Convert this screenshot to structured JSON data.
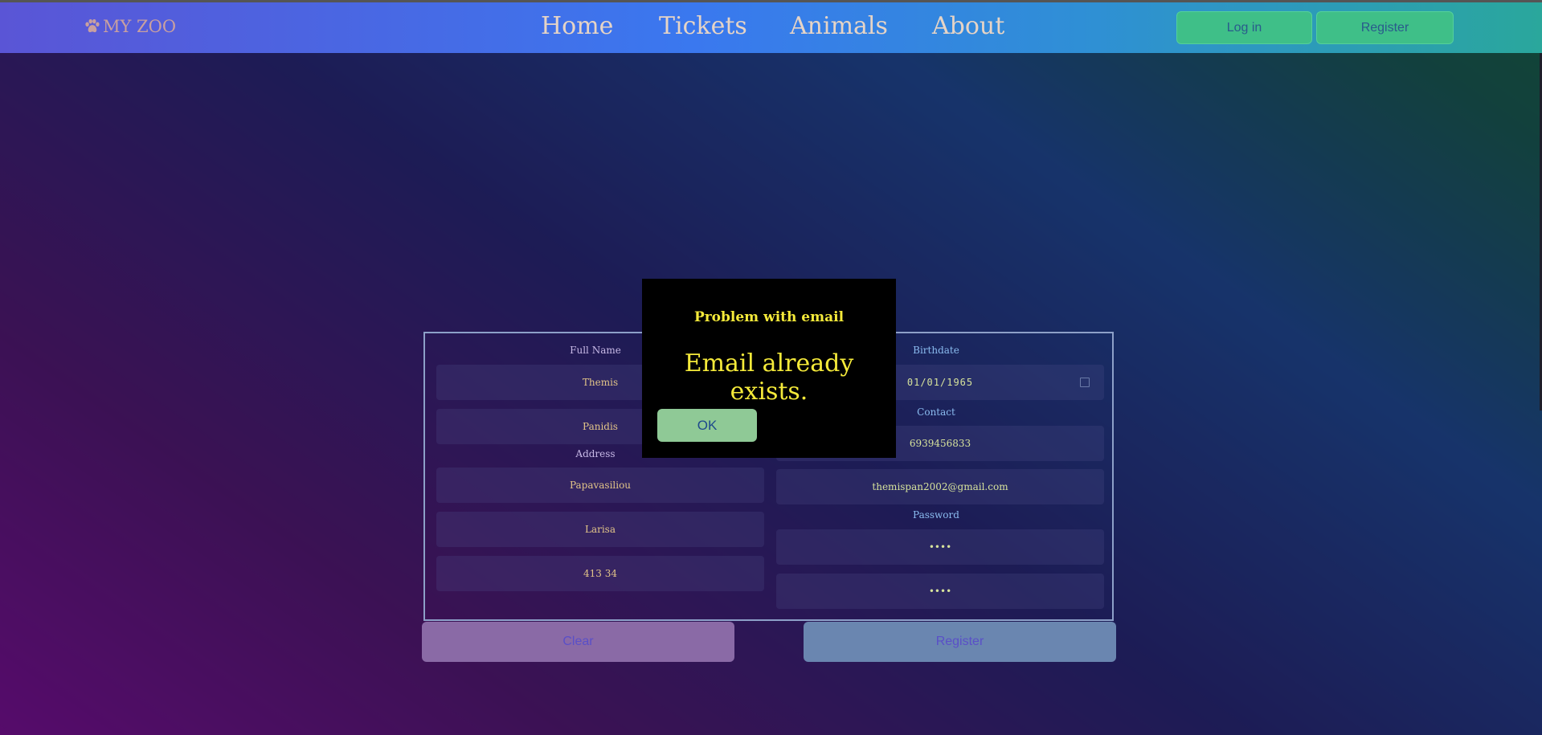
{
  "header": {
    "logo_text": "MY ZOO",
    "nav": [
      "Home",
      "Tickets",
      "Animals",
      "About"
    ],
    "login_label": "Log in",
    "register_label": "Register"
  },
  "form": {
    "left": {
      "full_name_label": "Full Name",
      "first_name_value": "Themis",
      "last_name_value": "Panidis",
      "address_label": "Address",
      "street_value": "Papavasiliou",
      "city_value": "Larisa",
      "zip_value": "413 34"
    },
    "right": {
      "birthdate_label": "Birthdate",
      "birthdate_value": "01/01/1965",
      "contact_label": "Contact",
      "phone_value": "6939456833",
      "email_value": "themispan2002@gmail.com",
      "password_label": "Password",
      "password_value": "••••",
      "confirm_password_value": "••••"
    },
    "clear_label": "Clear",
    "register_label": "Register"
  },
  "modal": {
    "title": "Problem with email",
    "message": "Email already exists.",
    "ok_label": "OK"
  },
  "colors": {
    "modal_text": "#f5ea3a",
    "label_left": "#c7b9e6",
    "label_right": "#8bbcf0"
  }
}
